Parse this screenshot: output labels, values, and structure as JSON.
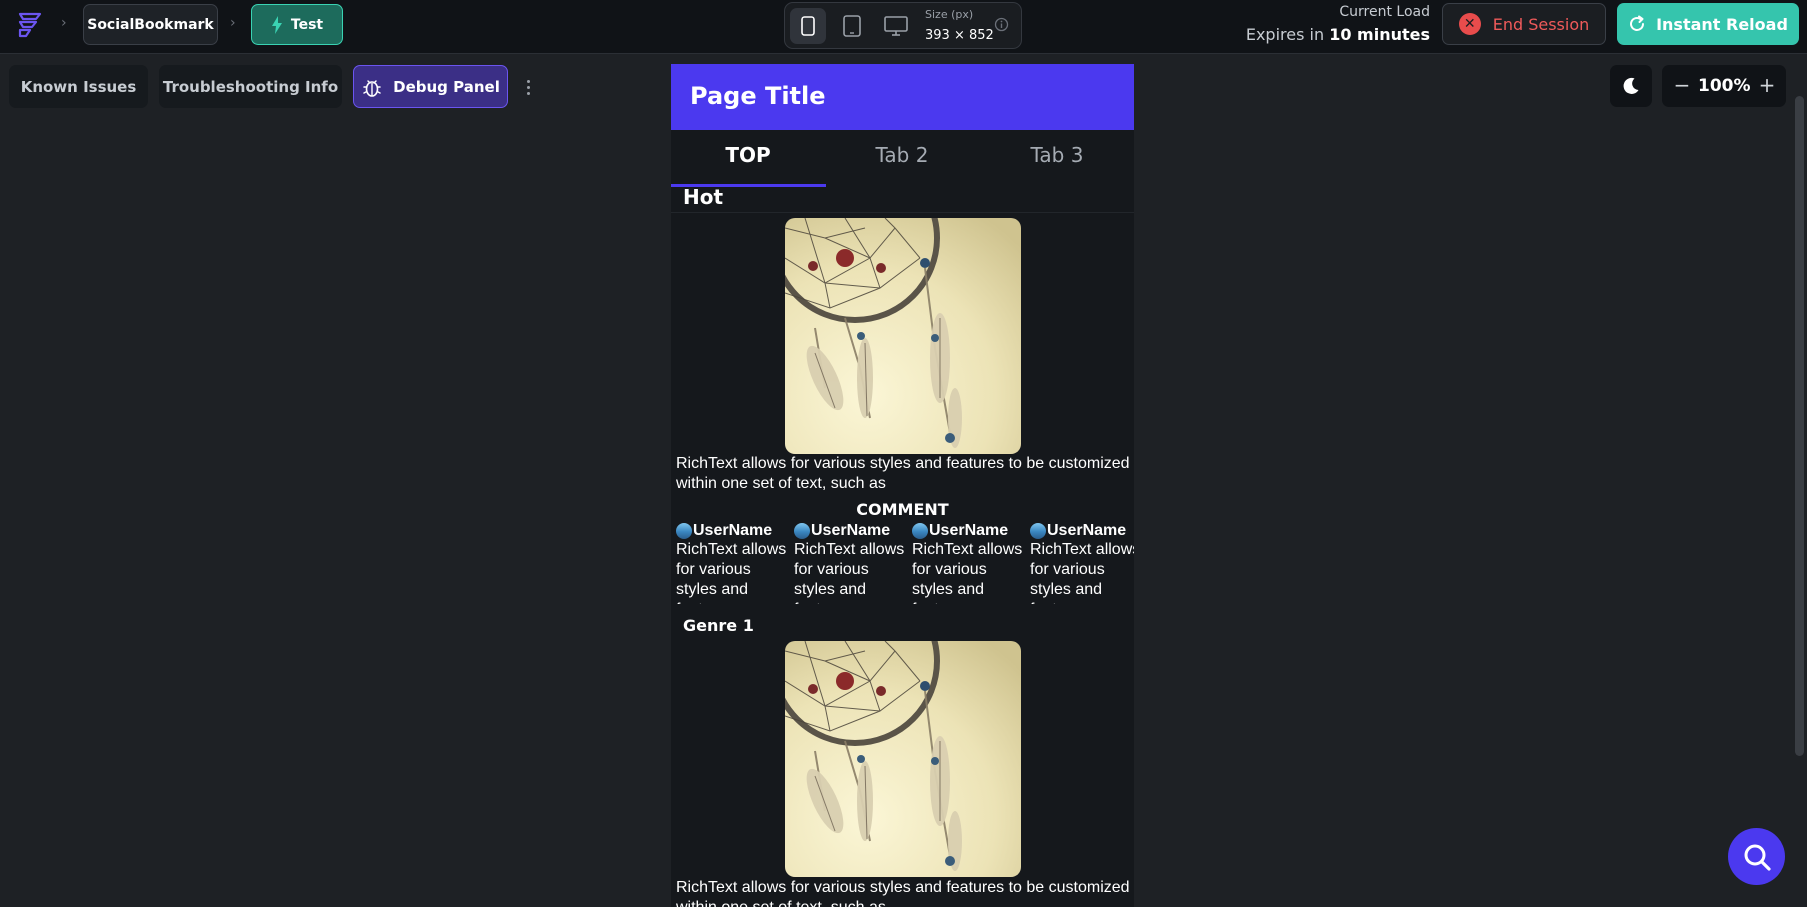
{
  "breadcrumb": {
    "app_name": "SocialBookmark",
    "mode_label": "Test"
  },
  "device_bar": {
    "size_label": "Size (px)",
    "size_value": "393 × 852"
  },
  "session": {
    "load_label": "Current Load",
    "expires_prefix": "Expires in",
    "expires_value": "10 minutes",
    "end_label": "End Session",
    "reload_label": "Instant Reload"
  },
  "toolbar": {
    "known_issues": "Known Issues",
    "troubleshooting": "Troubleshooting Info",
    "debug_panel": "Debug Panel",
    "zoom": "100%"
  },
  "preview": {
    "page_title": "Page Title",
    "tabs": [
      {
        "label": "TOP"
      },
      {
        "label": "Tab 2"
      },
      {
        "label": "Tab 3"
      }
    ],
    "hot_label": "Hot",
    "rich_text": "RichText allows for various styles and features to be customized within one set of text, such as",
    "comment_title": "COMMENT",
    "comments": [
      {
        "user": "UserName",
        "text": "RichText allows for various styles and features"
      },
      {
        "user": "UserName",
        "text": "RichText allows for various styles and features"
      },
      {
        "user": "UserName",
        "text": "RichText allows for various styles and features"
      },
      {
        "user": "UserName",
        "text": "RichText allows for various styles and features"
      }
    ],
    "genre_label": "Genre 1"
  },
  "colors": {
    "brand": "#4b39ef",
    "accent": "#35c5ad",
    "danger": "#e84c4c",
    "background": "#1e2125"
  }
}
